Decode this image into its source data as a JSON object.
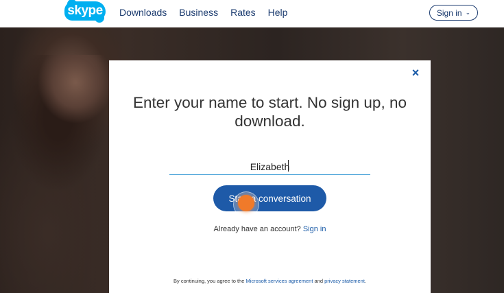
{
  "header": {
    "logo_text": "skype",
    "nav": [
      "Downloads",
      "Business",
      "Rates",
      "Help"
    ],
    "signin_label": "Sign in",
    "signin_chevron": "⌄"
  },
  "modal": {
    "close_icon": "×",
    "headline": "Enter your name to start. No sign up, no download.",
    "name_value": "Elizabeth",
    "start_label": "Start a conversation",
    "account_prefix": "Already have an account?",
    "account_link": "Sign in",
    "legal_prefix": "By continuing, you agree to the",
    "legal_link1": "Microsoft services agreement",
    "legal_and": "and",
    "legal_link2": "privacy statement",
    "legal_suffix": "."
  },
  "colors": {
    "brand": "#00aff0",
    "button": "#1e5aa8",
    "nav_text": "#1a3a6e"
  }
}
